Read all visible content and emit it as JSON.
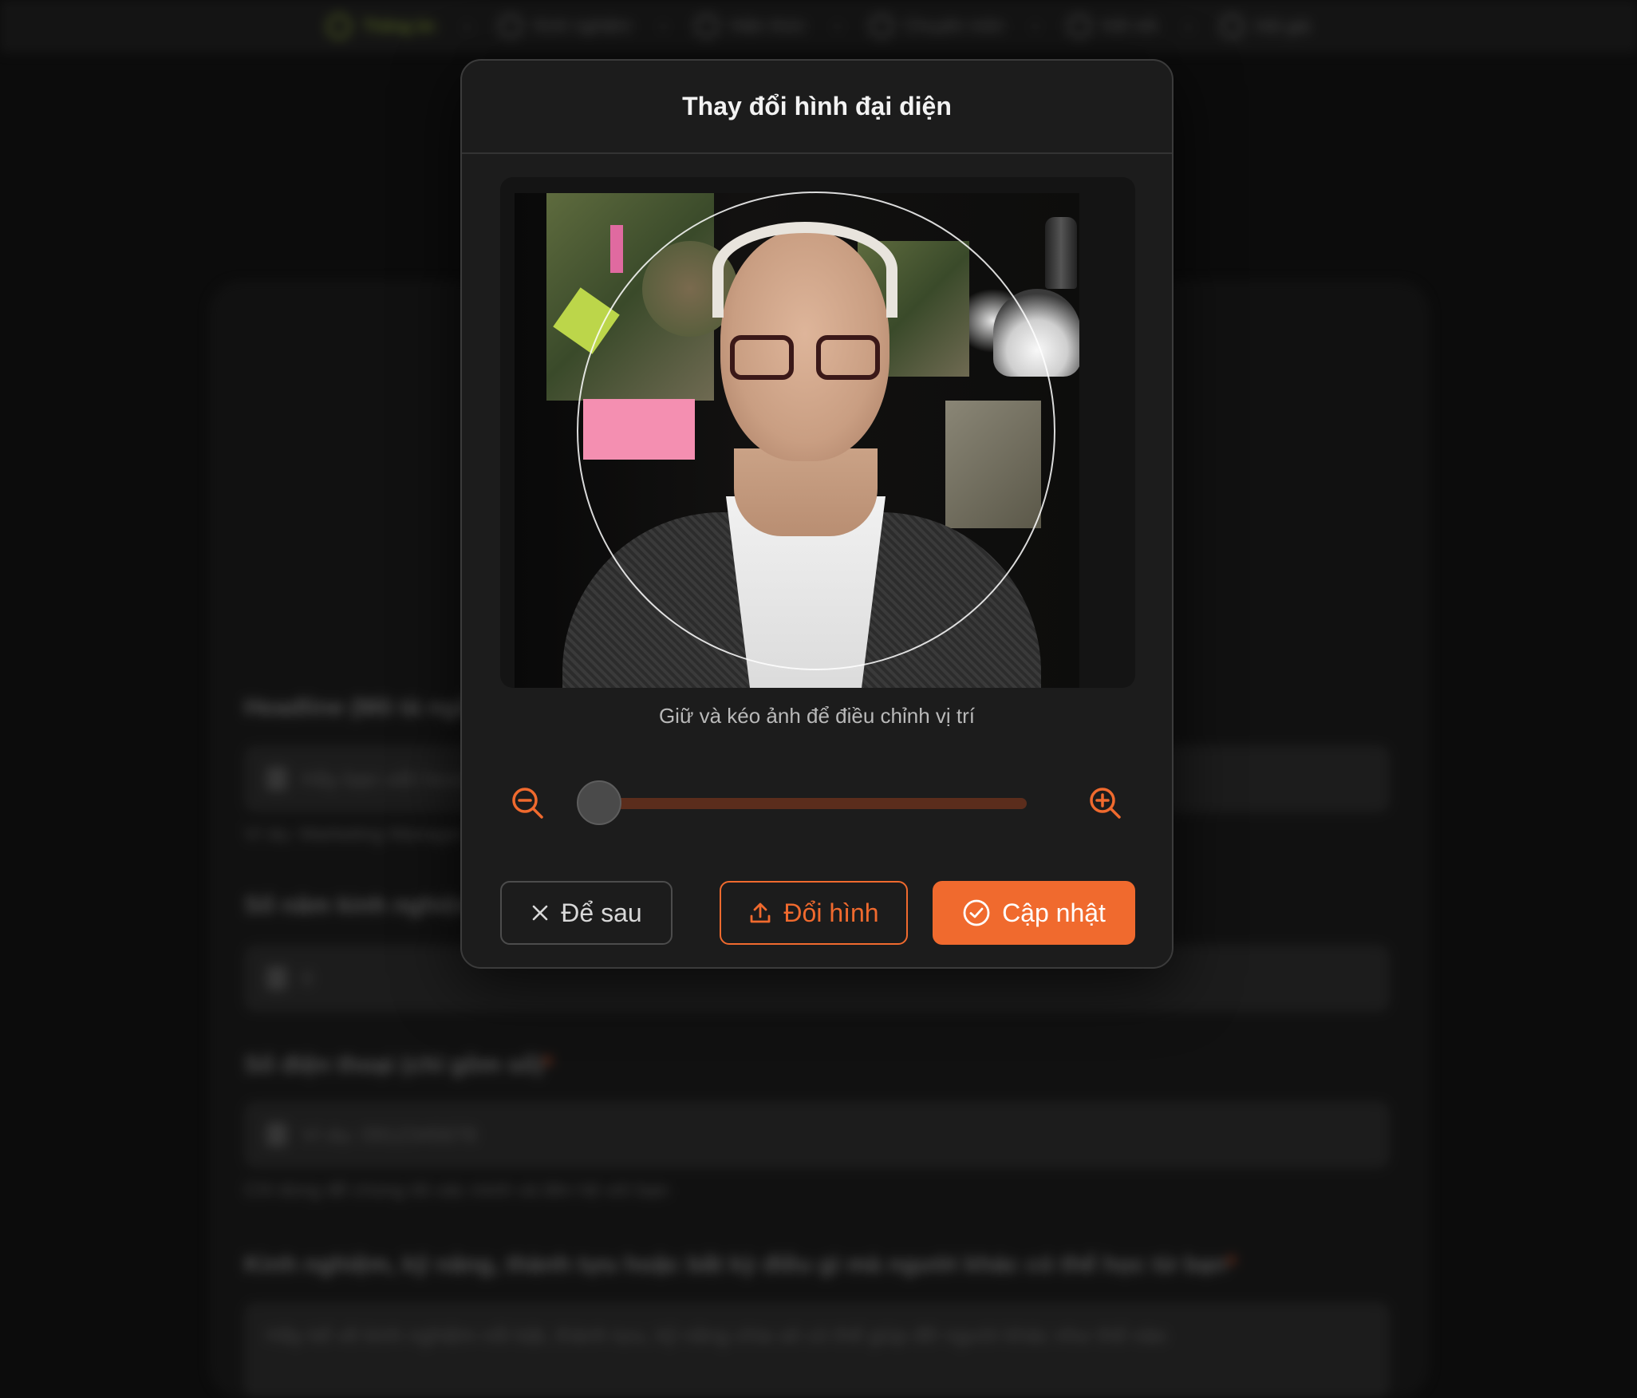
{
  "stepper": {
    "steps": [
      {
        "label": "Thông tin"
      },
      {
        "label": "Kinh nghiệm"
      },
      {
        "label": "Hiện thức"
      },
      {
        "label": "Chuyên môn"
      },
      {
        "label": "Kết nối"
      },
      {
        "label": "Hỏi giá"
      }
    ]
  },
  "background_form": {
    "headline_label": "Headline (Mô tả ngắn)",
    "headline_placeholder": "Hãy bạn viết headline...",
    "headline_hint": "Ví dụ: Marketing Manager",
    "years_label": "Số năm kinh nghiệm",
    "years_value": "0",
    "phone_label": "Số điện thoại (chỉ gồm số)",
    "phone_placeholder": "Ví dụ: 0912345678",
    "phone_hint": "Chỉ dùng để chúng tôi xác minh và liên hệ với bạn",
    "experience_label": "Kinh nghiệm, kỹ năng, thành tựu hoặc bất kỳ điều gì mà người khác có thể học từ bạn",
    "experience_placeholder": "Hãy kể về kinh nghiệm nổi bật, thành tựu, kỹ năng chia sẻ có thể giúp đỡ người khác như thế nào"
  },
  "modal": {
    "title": "Thay đổi hình đại diện",
    "hint": "Giữ và kéo ảnh để điều chỉnh vị trí",
    "zoom": {
      "value": 0.0,
      "min": 0,
      "max": 1
    },
    "buttons": {
      "later": "Để sau",
      "change": "Đổi hình",
      "update": "Cập nhật"
    }
  },
  "colors": {
    "accent": "#f06a2e",
    "slider_track": "#5b2d1c",
    "active_step": "#a7c83c",
    "modal_bg": "#1c1c1c"
  },
  "icons": {
    "zoom_out": "zoom-out-icon",
    "zoom_in": "zoom-in-icon",
    "close": "close-icon",
    "upload": "upload-icon",
    "check_circle": "check-circle-icon"
  }
}
